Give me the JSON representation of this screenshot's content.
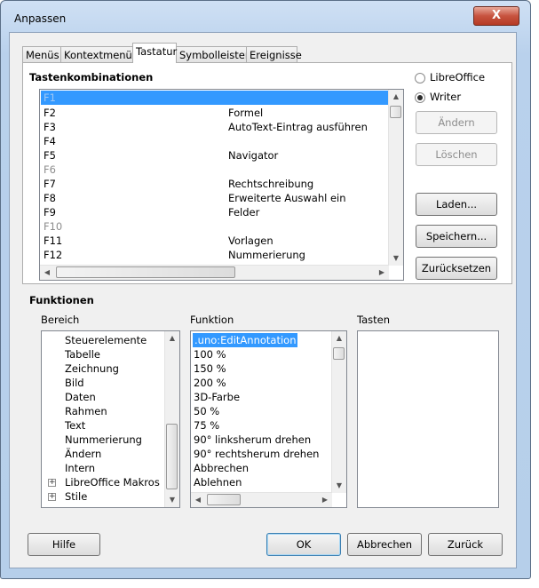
{
  "window": {
    "title": "Anpassen",
    "close_glyph": "X"
  },
  "tabs": [
    {
      "label": "Menüs"
    },
    {
      "label": "Kontextmenüs"
    },
    {
      "label": "Tastatur"
    },
    {
      "label": "Symbolleisten"
    },
    {
      "label": "Ereignisse"
    }
  ],
  "shortcuts": {
    "heading": "Tastenkombinationen",
    "rows": [
      {
        "key": "F1",
        "cmd": ""
      },
      {
        "key": "F2",
        "cmd": "Formel"
      },
      {
        "key": "F3",
        "cmd": "AutoText-Eintrag ausführen"
      },
      {
        "key": "F4",
        "cmd": ""
      },
      {
        "key": "F5",
        "cmd": "Navigator"
      },
      {
        "key": "F6",
        "cmd": ""
      },
      {
        "key": "F7",
        "cmd": "Rechtschreibung"
      },
      {
        "key": "F8",
        "cmd": "Erweiterte Auswahl ein"
      },
      {
        "key": "F9",
        "cmd": "Felder"
      },
      {
        "key": "F10",
        "cmd": ""
      },
      {
        "key": "F11",
        "cmd": "Vorlagen"
      },
      {
        "key": "F12",
        "cmd": "Nummerierung"
      }
    ]
  },
  "scope": {
    "libreoffice": "LibreOffice",
    "writer": "Writer"
  },
  "buttons": {
    "aendern": "Ändern",
    "loeschen": "Löschen",
    "laden": "Laden...",
    "speichern": "Speichern...",
    "zuruecksetzen": "Zurücksetzen",
    "hilfe": "Hilfe",
    "ok": "OK",
    "abbrechen": "Abbrechen",
    "zurueck": "Zurück"
  },
  "functions": {
    "heading": "Funktionen",
    "bereich_label": "Bereich",
    "funktion_label": "Funktion",
    "tasten_label": "Tasten",
    "bereich_items": [
      {
        "label": "Steuerelemente"
      },
      {
        "label": "Tabelle"
      },
      {
        "label": "Zeichnung"
      },
      {
        "label": "Bild"
      },
      {
        "label": "Daten"
      },
      {
        "label": "Rahmen"
      },
      {
        "label": "Text"
      },
      {
        "label": "Nummerierung"
      },
      {
        "label": "Ändern"
      },
      {
        "label": "Intern"
      },
      {
        "label": "LibreOffice Makros"
      },
      {
        "label": "Stile"
      }
    ],
    "funktion_items": [
      {
        "label": ".uno:EditAnnotation"
      },
      {
        "label": "100 %"
      },
      {
        "label": "150 %"
      },
      {
        "label": "200 %"
      },
      {
        "label": "3D-Farbe"
      },
      {
        "label": "50 %"
      },
      {
        "label": "75 %"
      },
      {
        "label": "90° linksherum drehen"
      },
      {
        "label": "90° rechtsherum drehen"
      },
      {
        "label": "Abbrechen"
      },
      {
        "label": "Ablehnen"
      }
    ]
  },
  "colors": {
    "selection": "#3399ff",
    "close": "#c7533f"
  }
}
